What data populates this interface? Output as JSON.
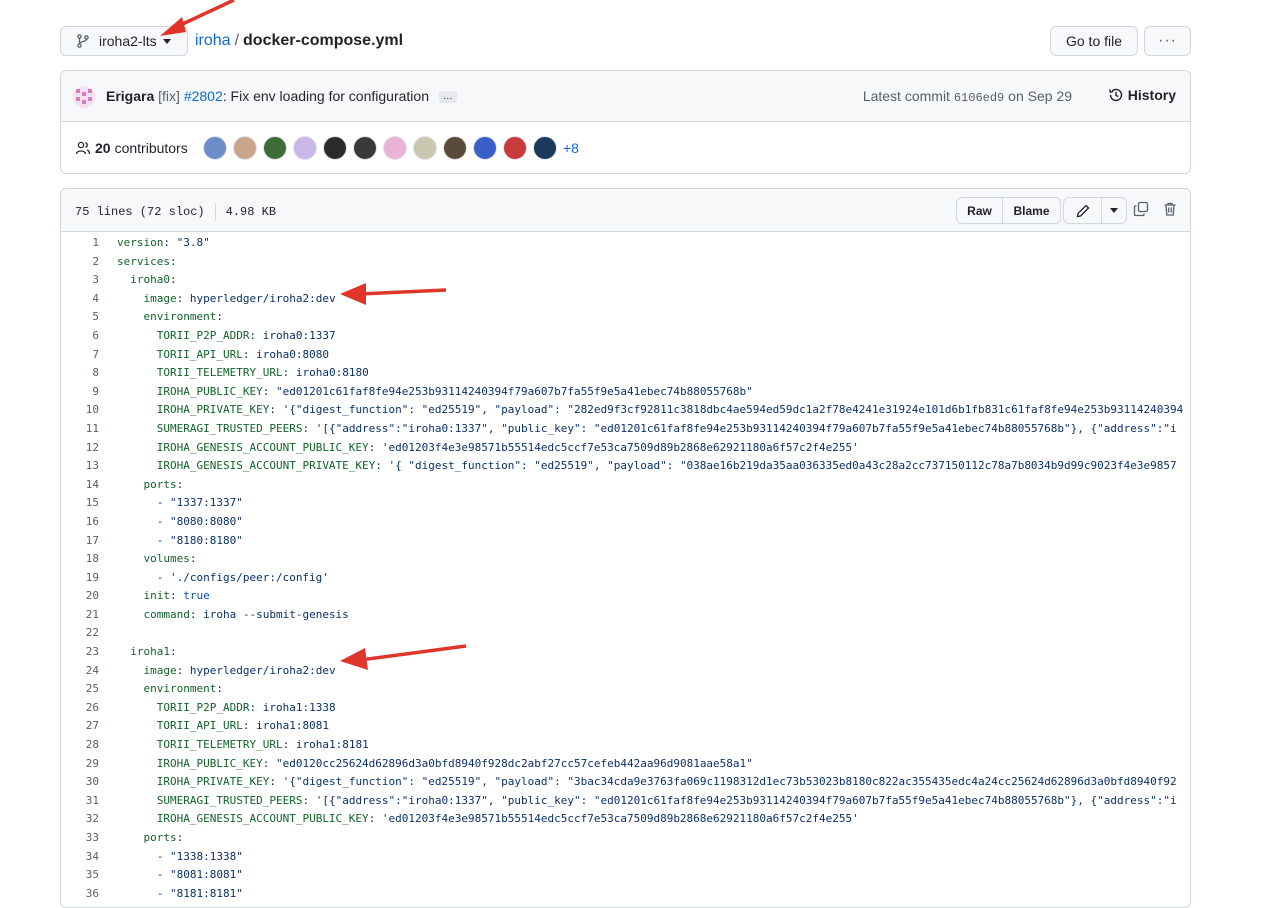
{
  "header": {
    "branch": "iroha2-lts",
    "repo": "iroha",
    "separator": "/",
    "file": "docker-compose.yml",
    "go_to_file": "Go to file",
    "more": "···"
  },
  "commit": {
    "author": "Erigara",
    "tag": "[fix]",
    "pr": "#2802",
    "message": ": Fix env loading for configuration",
    "ellipsis": "…",
    "latest_prefix": "Latest commit",
    "sha": "6106ed9",
    "date_text": "on Sep 29",
    "history": "History"
  },
  "contributors": {
    "count": "20",
    "label": "contributors",
    "more": "+8",
    "avatar_colors": [
      "#6e8cc7",
      "#c9a58a",
      "#3e6b3a",
      "#c9b8e6",
      "#2b2b2b",
      "#3a3a3a",
      "#e8b3d4",
      "#c8c8b0",
      "#5a4a3a",
      "#3b5ec7",
      "#c73b3b",
      "#1a3a5c"
    ]
  },
  "file_header": {
    "lines": "75 lines (72 sloc)",
    "size": "4.98 KB",
    "raw": "Raw",
    "blame": "Blame"
  },
  "code": [
    {
      "n": "1",
      "indent": "",
      "key": "version",
      "sep": ": ",
      "val": "\"3.8\"",
      "vtype": "s"
    },
    {
      "n": "2",
      "indent": "",
      "key": "services",
      "sep": ":",
      "val": "",
      "vtype": "s"
    },
    {
      "n": "3",
      "indent": "  ",
      "key": "iroha0",
      "sep": ":",
      "val": "",
      "vtype": "s"
    },
    {
      "n": "4",
      "indent": "    ",
      "key": "image",
      "sep": ": ",
      "val": "hyperledger/iroha2:dev",
      "vtype": "s"
    },
    {
      "n": "5",
      "indent": "    ",
      "key": "environment",
      "sep": ":",
      "val": "",
      "vtype": "s"
    },
    {
      "n": "6",
      "indent": "      ",
      "key": "TORII_P2P_ADDR",
      "sep": ": ",
      "val": "iroha0:1337",
      "vtype": "s"
    },
    {
      "n": "7",
      "indent": "      ",
      "key": "TORII_API_URL",
      "sep": ": ",
      "val": "iroha0:8080",
      "vtype": "s"
    },
    {
      "n": "8",
      "indent": "      ",
      "key": "TORII_TELEMETRY_URL",
      "sep": ": ",
      "val": "iroha0:8180",
      "vtype": "s"
    },
    {
      "n": "9",
      "indent": "      ",
      "key": "IROHA_PUBLIC_KEY",
      "sep": ": ",
      "val": "\"ed01201c61faf8fe94e253b93114240394f79a607b7fa55f9e5a41ebec74b88055768b\"",
      "vtype": "s"
    },
    {
      "n": "10",
      "indent": "      ",
      "key": "IROHA_PRIVATE_KEY",
      "sep": ": ",
      "val": "'{\"digest_function\": \"ed25519\", \"payload\": \"282ed9f3cf92811c3818dbc4ae594ed59dc1a2f78e4241e31924e101d6b1fb831c61faf8fe94e253b93114240394",
      "vtype": "s"
    },
    {
      "n": "11",
      "indent": "      ",
      "key": "SUMERAGI_TRUSTED_PEERS",
      "sep": ": ",
      "val": "'[{\"address\":\"iroha0:1337\", \"public_key\": \"ed01201c61faf8fe94e253b93114240394f79a607b7fa55f9e5a41ebec74b88055768b\"}, {\"address\":\"i",
      "vtype": "s"
    },
    {
      "n": "12",
      "indent": "      ",
      "key": "IROHA_GENESIS_ACCOUNT_PUBLIC_KEY",
      "sep": ": ",
      "val": "'ed01203f4e3e98571b55514edc5ccf7e53ca7509d89b2868e62921180a6f57c2f4e255'",
      "vtype": "s"
    },
    {
      "n": "13",
      "indent": "      ",
      "key": "IROHA_GENESIS_ACCOUNT_PRIVATE_KEY",
      "sep": ": ",
      "val": "'{ \"digest_function\": \"ed25519\", \"payload\": \"038ae16b219da35aa036335ed0a43c28a2cc737150112c78a7b8034b9d99c9023f4e3e9857",
      "vtype": "s"
    },
    {
      "n": "14",
      "indent": "    ",
      "key": "ports",
      "sep": ":",
      "val": "",
      "vtype": "s"
    },
    {
      "n": "15",
      "indent": "      - ",
      "key": "",
      "sep": "",
      "val": "\"1337:1337\"",
      "vtype": "s"
    },
    {
      "n": "16",
      "indent": "      - ",
      "key": "",
      "sep": "",
      "val": "\"8080:8080\"",
      "vtype": "s"
    },
    {
      "n": "17",
      "indent": "      - ",
      "key": "",
      "sep": "",
      "val": "\"8180:8180\"",
      "vtype": "s"
    },
    {
      "n": "18",
      "indent": "    ",
      "key": "volumes",
      "sep": ":",
      "val": "",
      "vtype": "s"
    },
    {
      "n": "19",
      "indent": "      - ",
      "key": "",
      "sep": "",
      "val": "'./configs/peer:/config'",
      "vtype": "s"
    },
    {
      "n": "20",
      "indent": "    ",
      "key": "init",
      "sep": ": ",
      "val": "true",
      "vtype": "b"
    },
    {
      "n": "21",
      "indent": "    ",
      "key": "command",
      "sep": ": ",
      "val": "iroha --submit-genesis",
      "vtype": "s"
    },
    {
      "n": "22",
      "indent": "",
      "key": "",
      "sep": "",
      "val": "",
      "vtype": "s"
    },
    {
      "n": "23",
      "indent": "  ",
      "key": "iroha1",
      "sep": ":",
      "val": "",
      "vtype": "s"
    },
    {
      "n": "24",
      "indent": "    ",
      "key": "image",
      "sep": ": ",
      "val": "hyperledger/iroha2:dev",
      "vtype": "s"
    },
    {
      "n": "25",
      "indent": "    ",
      "key": "environment",
      "sep": ":",
      "val": "",
      "vtype": "s"
    },
    {
      "n": "26",
      "indent": "      ",
      "key": "TORII_P2P_ADDR",
      "sep": ": ",
      "val": "iroha1:1338",
      "vtype": "s"
    },
    {
      "n": "27",
      "indent": "      ",
      "key": "TORII_API_URL",
      "sep": ": ",
      "val": "iroha1:8081",
      "vtype": "s"
    },
    {
      "n": "28",
      "indent": "      ",
      "key": "TORII_TELEMETRY_URL",
      "sep": ": ",
      "val": "iroha1:8181",
      "vtype": "s"
    },
    {
      "n": "29",
      "indent": "      ",
      "key": "IROHA_PUBLIC_KEY",
      "sep": ": ",
      "val": "\"ed0120cc25624d62896d3a0bfd8940f928dc2abf27cc57cefeb442aa96d9081aae58a1\"",
      "vtype": "s"
    },
    {
      "n": "30",
      "indent": "      ",
      "key": "IROHA_PRIVATE_KEY",
      "sep": ": ",
      "val": "'{\"digest_function\": \"ed25519\", \"payload\": \"3bac34cda9e3763fa069c1198312d1ec73b53023b8180c822ac355435edc4a24cc25624d62896d3a0bfd8940f92",
      "vtype": "s"
    },
    {
      "n": "31",
      "indent": "      ",
      "key": "SUMERAGI_TRUSTED_PEERS",
      "sep": ": ",
      "val": "'[{\"address\":\"iroha0:1337\", \"public_key\": \"ed01201c61faf8fe94e253b93114240394f79a607b7fa55f9e5a41ebec74b88055768b\"}, {\"address\":\"i",
      "vtype": "s"
    },
    {
      "n": "32",
      "indent": "      ",
      "key": "IROHA_GENESIS_ACCOUNT_PUBLIC_KEY",
      "sep": ": ",
      "val": "'ed01203f4e3e98571b55514edc5ccf7e53ca7509d89b2868e62921180a6f57c2f4e255'",
      "vtype": "s"
    },
    {
      "n": "33",
      "indent": "    ",
      "key": "ports",
      "sep": ":",
      "val": "",
      "vtype": "s"
    },
    {
      "n": "34",
      "indent": "      - ",
      "key": "",
      "sep": "",
      "val": "\"1338:1338\"",
      "vtype": "s"
    },
    {
      "n": "35",
      "indent": "      - ",
      "key": "",
      "sep": "",
      "val": "\"8081:8081\"",
      "vtype": "s"
    },
    {
      "n": "36",
      "indent": "      - ",
      "key": "",
      "sep": "",
      "val": "\"8181:8181\"",
      "vtype": "s"
    }
  ],
  "colors": {
    "annotation_arrow": "#e0352b",
    "link": "#0969da"
  }
}
